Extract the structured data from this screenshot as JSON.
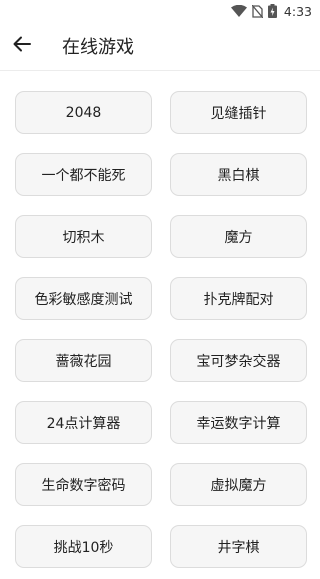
{
  "status_bar": {
    "time": "4:33",
    "icons": [
      "wifi-icon",
      "no-sim-icon",
      "battery-charging-icon"
    ]
  },
  "header": {
    "back_icon": "arrow-left-icon",
    "title": "在线游戏"
  },
  "games": [
    {
      "label": "2048"
    },
    {
      "label": "见缝插针"
    },
    {
      "label": "一个都不能死"
    },
    {
      "label": "黑白棋"
    },
    {
      "label": "切积木"
    },
    {
      "label": "魔方"
    },
    {
      "label": "色彩敏感度测试"
    },
    {
      "label": "扑克牌配对"
    },
    {
      "label": "蔷薇花园"
    },
    {
      "label": "宝可梦杂交器"
    },
    {
      "label": "24点计算器"
    },
    {
      "label": "幸运数字计算"
    },
    {
      "label": "生命数字密码"
    },
    {
      "label": "虚拟魔方"
    },
    {
      "label": "挑战10秒"
    },
    {
      "label": "井字棋"
    }
  ]
}
